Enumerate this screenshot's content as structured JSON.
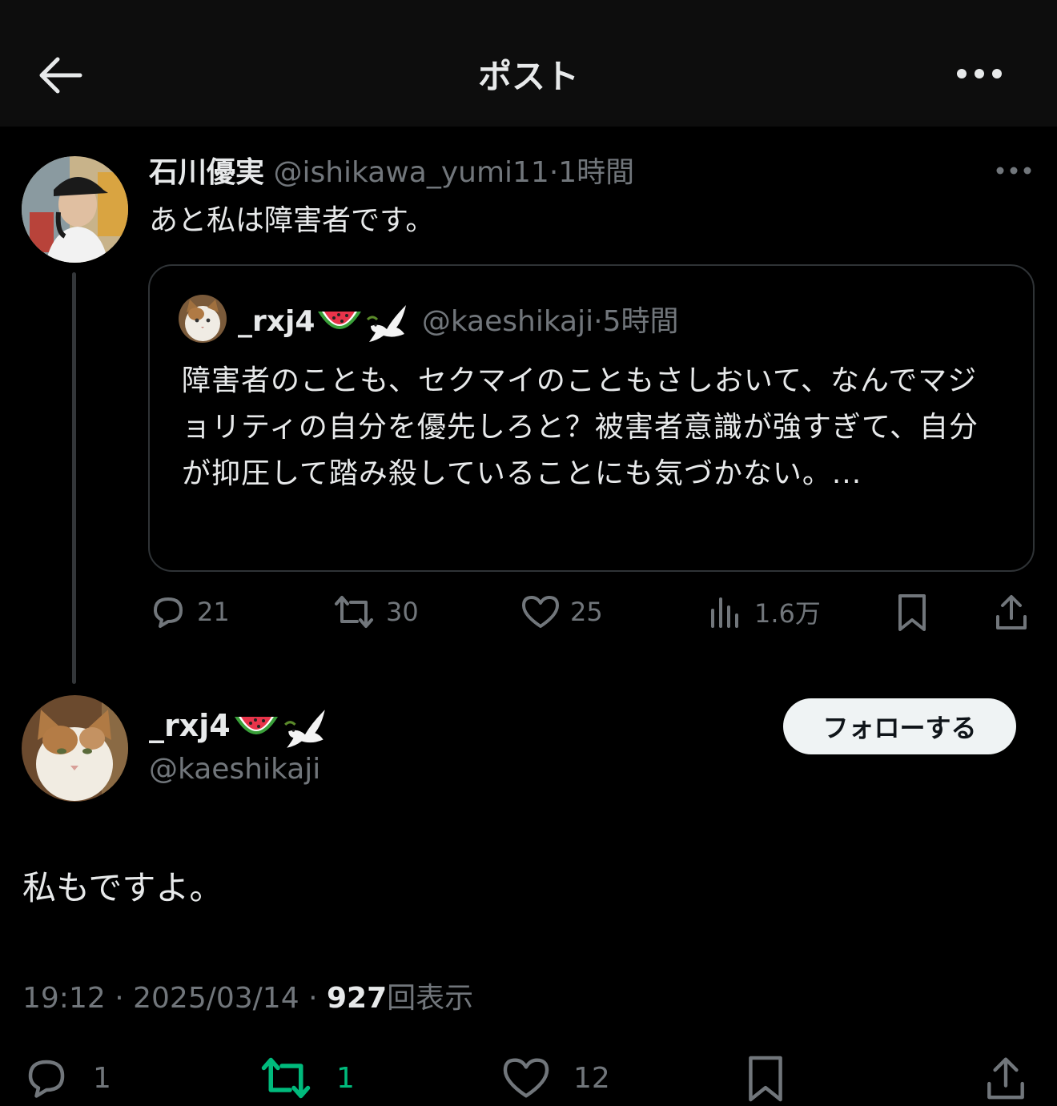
{
  "header": {
    "title": "ポスト"
  },
  "parent_post": {
    "author_name": "石川優実",
    "handle": "@ishikawa_yumi11",
    "separator": "·",
    "time": "1時間",
    "text": "あと私は障害者です。",
    "quote": {
      "author_name": "_rxj4",
      "emojis": [
        "watermelon",
        "dove"
      ],
      "handle": "@kaeshikaji",
      "separator": "·",
      "time": "5時間",
      "text": "障害者のことも、セクマイのこともさしおいて、なんでマジョリティの自分を優先しろと？被害者意識が強すぎて、自分が抑圧して踏み殺していることにも気づかない。..."
    },
    "stats": {
      "replies": "21",
      "reposts": "30",
      "likes": "25",
      "views": "1.6万"
    }
  },
  "main_post": {
    "author_name": "_rxj4",
    "emojis": [
      "watermelon",
      "dove"
    ],
    "handle": "@kaeshikaji",
    "follow_label": "フォローする",
    "text": "私もですよ。",
    "time": "19:12",
    "date": "2025/03/14",
    "separator": "·",
    "view_count": "927",
    "view_label": "回表示",
    "stats": {
      "replies": "1",
      "reposts": "1",
      "likes": "12"
    }
  },
  "colors": {
    "background": "#000000",
    "text": "#e7e9ea",
    "muted": "#71767b",
    "border": "#2f3336",
    "repost_active": "#00ba7c"
  }
}
